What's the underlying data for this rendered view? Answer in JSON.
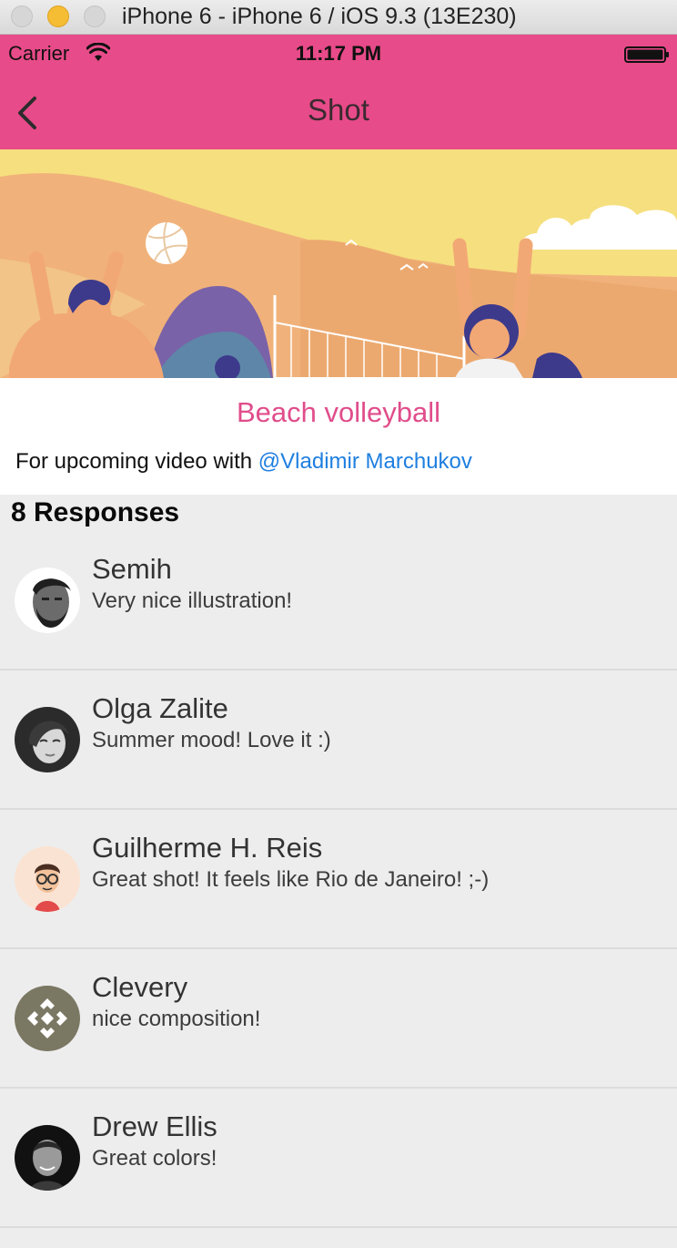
{
  "simulator": {
    "window_title": "iPhone 6 - iPhone 6 / iOS 9.3 (13E230)"
  },
  "status_bar": {
    "carrier": "Carrier",
    "time": "11:17 PM"
  },
  "nav": {
    "title": "Shot",
    "back_icon": "chevron-left-icon"
  },
  "shot": {
    "title": "Beach volleyball",
    "description_prefix": "For upcoming video with ",
    "mention": "@Vladimir Marchukov"
  },
  "responses": {
    "heading": "8 Responses",
    "items": [
      {
        "name": "Semih",
        "comment": "Very nice illustration!"
      },
      {
        "name": "Olga Zalite",
        "comment": "Summer mood! Love it :)"
      },
      {
        "name": "Guilherme H. Reis",
        "comment": "Great shot! It feels like Rio de Janeiro! ;-)"
      },
      {
        "name": "Clevery",
        "comment": "nice composition!"
      },
      {
        "name": "Drew Ellis",
        "comment": "Great colors!"
      }
    ]
  },
  "colors": {
    "accent": "#e84b89",
    "link": "#1f7fe0",
    "list_background": "#ededed"
  }
}
